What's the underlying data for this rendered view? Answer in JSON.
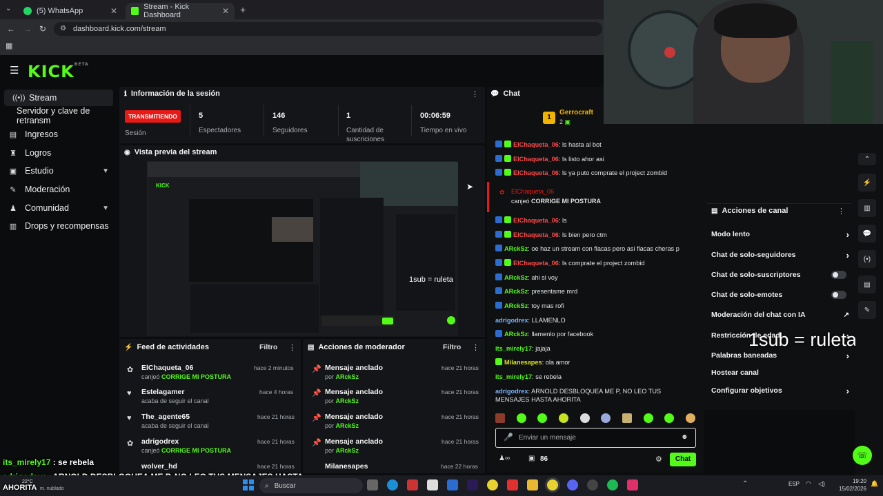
{
  "browser": {
    "tabs": [
      {
        "label": "(5) WhatsApp",
        "icon": "whatsapp-icon",
        "color": "#25d366"
      },
      {
        "label": "Stream - Kick Dashboard",
        "icon": "kick-icon",
        "color": "#53fc18"
      }
    ],
    "url": "dashboard.kick.com/stream"
  },
  "logo": {
    "text": "KICK",
    "beta": "BETA"
  },
  "sidebar": {
    "items": [
      {
        "label": "Stream",
        "icon": "broadcast-icon",
        "active": true
      },
      {
        "label": "Servidor y clave de retransm"
      },
      {
        "label": "Ingresos",
        "icon": "revenue-icon"
      },
      {
        "label": "Logros",
        "icon": "trophy-icon"
      },
      {
        "label": "Estudio",
        "icon": "studio-icon"
      },
      {
        "label": "Moderación",
        "icon": "wrench-icon"
      },
      {
        "label": "Comunidad",
        "icon": "community-icon"
      },
      {
        "label": "Drops y recompensas",
        "icon": "drops-icon"
      }
    ]
  },
  "session": {
    "title": "Información de la sesión",
    "status_badge": "TRANSMITIENDO",
    "status_label": "Sesión",
    "stats": [
      {
        "value": "5",
        "label": "Espectadores"
      },
      {
        "value": "146",
        "label": "Seguidores"
      },
      {
        "value": "1",
        "label": "Cantidad de suscriciones"
      },
      {
        "value": "00:06:59",
        "label": "Tiempo en vivo"
      }
    ]
  },
  "preview": {
    "title": "Vista previa del stream",
    "overlay": "1sub = ruleta"
  },
  "activity_feed": {
    "title": "Feed de actividades",
    "filter_label": "Filtro",
    "items": [
      {
        "name": "ElChaqueta_06",
        "sub_prefix": "canjeó",
        "sub_highlight": "CORRIGE MI POSTURA",
        "time": "hace 2 minutos",
        "icon": "reward-icon"
      },
      {
        "name": "Estelagamer",
        "sub_prefix": "acaba de seguir el canal",
        "sub_highlight": "",
        "time": "hace 4 horas",
        "icon": "heart-icon"
      },
      {
        "name": "The_agente65",
        "sub_prefix": "acaba de seguir el canal",
        "sub_highlight": "",
        "time": "hace 21 horas",
        "icon": "heart-icon"
      },
      {
        "name": "adrigodrex",
        "sub_prefix": "canjeó",
        "sub_highlight": "CORRIGE MI POSTURA",
        "time": "hace 21 horas",
        "icon": "reward-icon"
      },
      {
        "name": "wolver_hd",
        "sub_prefix": "",
        "sub_highlight": "",
        "time": "hace 21 horas",
        "icon": "reward-icon"
      }
    ]
  },
  "mod_actions": {
    "title": "Acciones de moderador",
    "filter_label": "Filtro",
    "items": [
      {
        "title": "Mensaje anclado",
        "by": "por",
        "user": "ARckSz",
        "time": "hace 21 horas"
      },
      {
        "title": "Mensaje anclado",
        "by": "por",
        "user": "ARckSz",
        "time": "hace 21 horas"
      },
      {
        "title": "Mensaje anclado",
        "by": "por",
        "user": "ARckSz",
        "time": "hace 21 horas"
      },
      {
        "title": "Mensaje anclado",
        "by": "por",
        "user": "ARckSz",
        "time": "hace 21 horas"
      },
      {
        "title": "Milanesapes",
        "by": "",
        "user": "",
        "time": "hace 22 horas"
      }
    ]
  },
  "chat": {
    "title": "Chat",
    "gifter": {
      "name": "Gerrocraft",
      "count": "2",
      "rank": "1"
    },
    "messages": [
      {
        "user": "ElChaqueta_06",
        "color": "red",
        "badges": [
          "b",
          "g"
        ],
        "text": "ls hasta al bot"
      },
      {
        "user": "ElChaqueta_06",
        "color": "red",
        "badges": [
          "b",
          "g"
        ],
        "text": "ls listo ahor asi"
      },
      {
        "user": "ElChaqueta_06",
        "color": "red",
        "badges": [
          "b",
          "g"
        ],
        "text": "ls ya puto comprate el project zombid"
      },
      {
        "user": "ElChaqueta_06",
        "color": "red",
        "badges": [
          "b",
          "g"
        ],
        "text": "ls"
      },
      {
        "user": "ElChaqueta_06",
        "color": "red",
        "badges": [
          "b",
          "g"
        ],
        "text": "ls bien pero ctm"
      },
      {
        "user": "ARckSz",
        "color": "green",
        "badges": [
          "b"
        ],
        "text": "oe haz un stream con flacas pero asi flacas cheras p"
      },
      {
        "user": "ElChaqueta_06",
        "color": "red",
        "badges": [
          "b",
          "g"
        ],
        "text": "ls comprate el project zombid"
      },
      {
        "user": "ARckSz",
        "color": "green",
        "badges": [
          "b"
        ],
        "text": "ahi si voy"
      },
      {
        "user": "ARckSz",
        "color": "green",
        "badges": [
          "b"
        ],
        "text": "presentame mrd"
      },
      {
        "user": "ARckSz",
        "color": "green",
        "badges": [
          "b"
        ],
        "text": "toy mas rofi"
      },
      {
        "user": "adrigodrex",
        "color": "blue",
        "badges": [],
        "text": "LLAMENLO"
      },
      {
        "user": "ARckSz",
        "color": "green",
        "badges": [
          "b"
        ],
        "text": "llamenlo por facebook"
      },
      {
        "user": "its_mirely17",
        "color": "green",
        "badges": [],
        "text": "jajaja"
      },
      {
        "user": "Milanesapes",
        "color": "yellow",
        "badges": [
          "g"
        ],
        "text": "ola amor"
      },
      {
        "user": "its_mirely17",
        "color": "green",
        "badges": [],
        "text": "se rebela"
      },
      {
        "user": "adrigodrex",
        "color": "blue",
        "badges": [],
        "text": "ARNOLD DESBLOQUEA ME P, NO LEO TUS MENSAJES HASTA AHORITA"
      }
    ],
    "redemption": {
      "user": "ElChaqueta_06",
      "text_prefix": "canjeó",
      "text_highlight": "CORRIGE MI POSTURA"
    },
    "input_placeholder": "Enviar un mensaje",
    "points": "86",
    "send_label": "Chat"
  },
  "channel_actions": {
    "title": "Acciones de canal",
    "items": [
      {
        "label": "Modo lento",
        "control": "arrow"
      },
      {
        "label": "Chat de solo-seguidores",
        "control": "arrow"
      },
      {
        "label": "Chat de solo-suscriptores",
        "control": "toggle"
      },
      {
        "label": "Chat de solo-emotes",
        "control": "toggle"
      },
      {
        "label": "Moderación del chat con IA",
        "control": "link"
      },
      {
        "label": "Restricción de edad",
        "control": "arrow"
      },
      {
        "label": "Palabras baneadas",
        "control": "arrow"
      },
      {
        "label": "Hostear canal",
        "control": "none"
      },
      {
        "label": "Configurar objetivos",
        "control": "arrow"
      }
    ],
    "overlay": "1sub = ruleta"
  },
  "stream_overlay": {
    "line1_user": "its_mirely17",
    "line1_text": " : se rebela",
    "line2_user": "adrigodrex",
    "line2_text": " : ARNOLD DESBLOQUEA ME P, NO LEO TUS MENSAJES HASTA",
    "line3_text": "AHORITA"
  },
  "taskbar": {
    "weather": "22°C",
    "weather_desc": "m. nublado",
    "search": "Buscar",
    "lang": "ESP",
    "time": "19:20",
    "date": "15/02/2026"
  },
  "colors": {
    "accent": "#53fc18",
    "live": "#e91916"
  }
}
